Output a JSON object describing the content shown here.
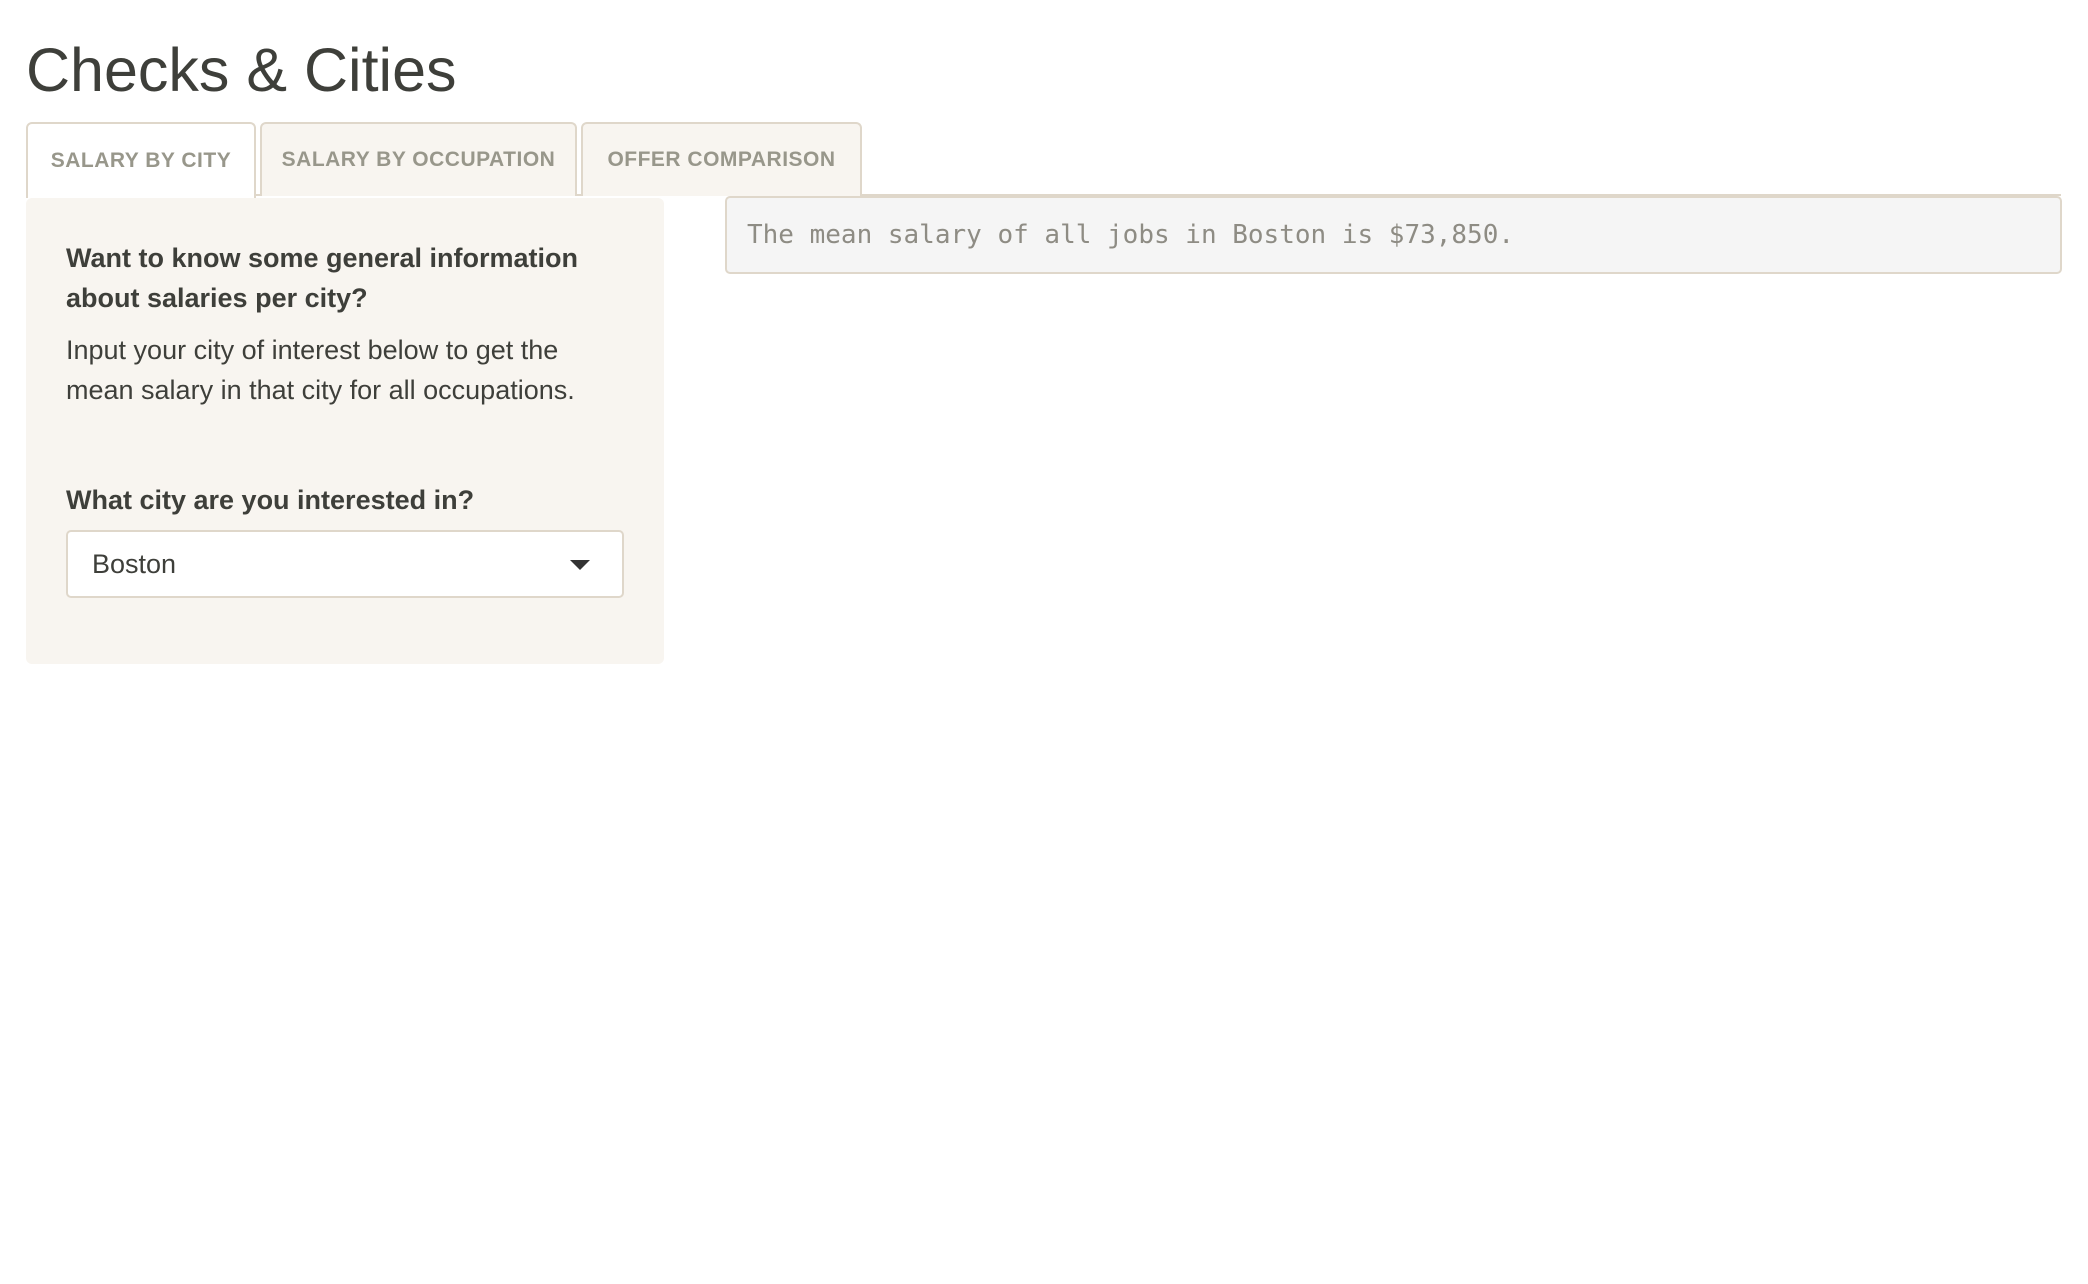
{
  "app": {
    "title": "Checks & Cities"
  },
  "tabs": [
    {
      "label": "SALARY BY CITY",
      "active": true
    },
    {
      "label": "SALARY BY OCCUPATION",
      "active": false
    },
    {
      "label": "OFFER COMPARISON",
      "active": false
    }
  ],
  "sidebar": {
    "heading": "Want to know some general information about salaries per city?",
    "description": "Input your city of interest below to get the mean salary in that city for all occupations.",
    "city_label": "What city are you interested in?",
    "city_selected": "Boston"
  },
  "output": {
    "text": "The mean salary of all jobs in Boston is $73,850."
  },
  "colors": {
    "text": "#3e3f3a",
    "tab_text": "#98978b",
    "panel_bg": "#f8f5f0",
    "border": "#dfd7ca",
    "output_bg": "#f5f5f5",
    "output_text": "#8e8c84"
  },
  "icons": {
    "select_caret": "caret-down-icon"
  }
}
